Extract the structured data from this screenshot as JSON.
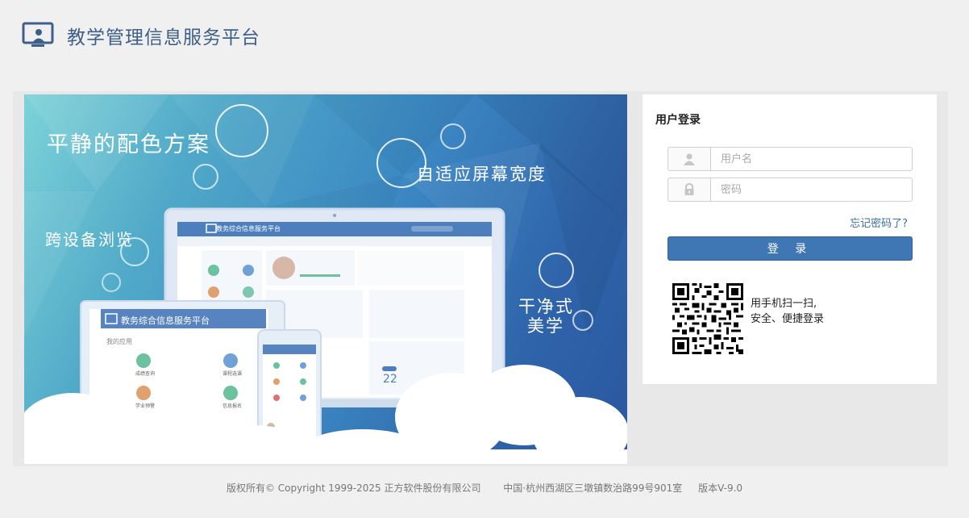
{
  "header": {
    "title": "教学管理信息服务平台"
  },
  "banner": {
    "slogans": [
      "平静的配色方案",
      "自适应屏幕宽度",
      "跨设备浏览",
      "干净式",
      "美学"
    ],
    "mockup_title": "教务综合信息服务平台",
    "tablet_title": "教务综合信息服务平台",
    "tablet_section": "我的应用",
    "tablet_apps": [
      "成绩查询",
      "课程选课",
      "学业预警",
      "信息报名"
    ],
    "calendar_day": "22"
  },
  "login": {
    "title": "用户登录",
    "username_placeholder": "用户名",
    "username_value": "",
    "password_placeholder": "密码",
    "password_value": "",
    "forgot_link": "忘记密码了?",
    "submit_label": "登 录",
    "qr_caption_line1": "用手机扫一扫,",
    "qr_caption_line2": "安全、便捷登录"
  },
  "footer": {
    "copyright": "版权所有© Copyright 1999-2025 正方软件股份有限公司",
    "address": "中国·杭州西湖区三墩镇数治路99号901室",
    "version": "版本V-9.0"
  },
  "colors": {
    "title": "#3e5f87",
    "primary_button": "#3f76b4",
    "link": "#3a6ea5",
    "banner_start": "#7dd3d8",
    "banner_end": "#2a57a0"
  },
  "icons": {
    "logo": "screen-person-icon",
    "username": "user-icon",
    "password": "lock-icon",
    "qr": "qr-code"
  }
}
